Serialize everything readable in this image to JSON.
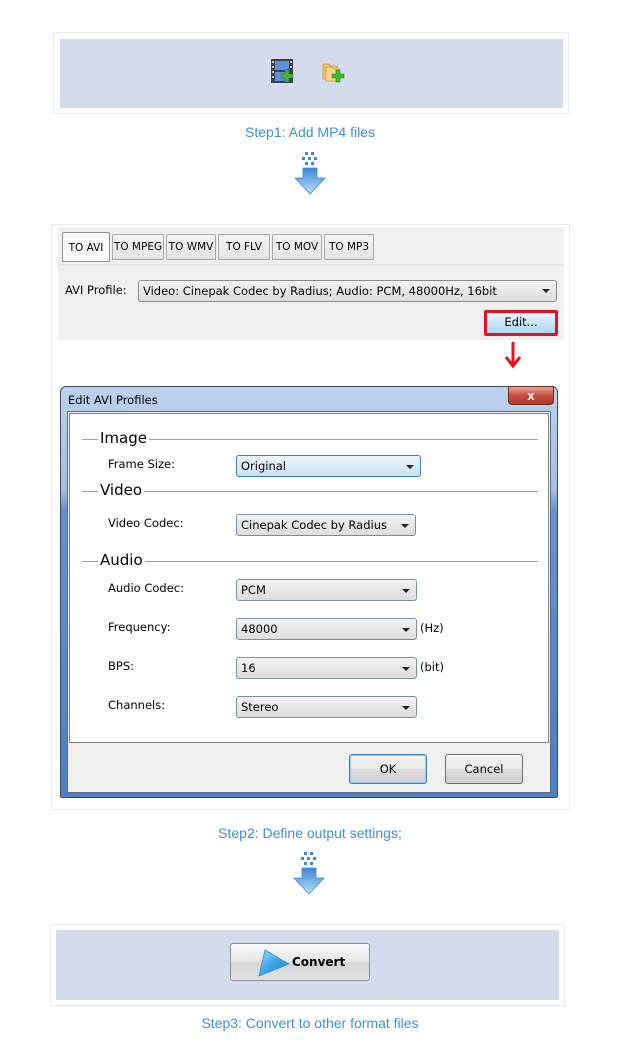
{
  "step1": {
    "caption": "Step1: Add MP4 files",
    "buttons": [
      {
        "name": "add-video-file",
        "icon": "film-add-icon"
      },
      {
        "name": "add-folder",
        "icon": "folder-add-icon"
      }
    ]
  },
  "step2": {
    "caption": "Step2: Define output settings;",
    "tabs": [
      {
        "label": "TO AVI",
        "active": true
      },
      {
        "label": "TO MPEG",
        "active": false
      },
      {
        "label": "TO WMV",
        "active": false
      },
      {
        "label": "TO FLV",
        "active": false
      },
      {
        "label": "TO MOV",
        "active": false
      },
      {
        "label": "TO MP3",
        "active": false
      }
    ],
    "profile_label": "AVI Profile:",
    "profile_value": "Video: Cinepak Codec by Radius; Audio: PCM, 48000Hz, 16bit",
    "edit_button": "Edit...",
    "highlight_color": "#e8101e"
  },
  "dialog": {
    "title": "Edit AVI Profiles",
    "close_glyph": "x",
    "groups": {
      "image": "Image",
      "video": "Video",
      "audio": "Audio"
    },
    "fields": {
      "frame_size": {
        "label": "Frame Size:",
        "value": "Original"
      },
      "video_codec": {
        "label": "Video Codec:",
        "value": "Cinepak Codec by Radius"
      },
      "audio_codec": {
        "label": "Audio Codec:",
        "value": "PCM"
      },
      "frequency": {
        "label": "Frequency:",
        "value": "48000",
        "unit": "(Hz)"
      },
      "bps": {
        "label": "BPS:",
        "value": "16",
        "unit": "(bit)"
      },
      "channels": {
        "label": "Channels:",
        "value": "Stereo"
      }
    },
    "ok_button": "OK",
    "cancel_button": "Cancel"
  },
  "step3": {
    "caption": "Step3: Convert to other format files",
    "convert_button": "Convert"
  },
  "colors": {
    "caption": "#3d8fd8",
    "frame_fill": "#d4dbec",
    "arrow": "#4a9be6"
  }
}
